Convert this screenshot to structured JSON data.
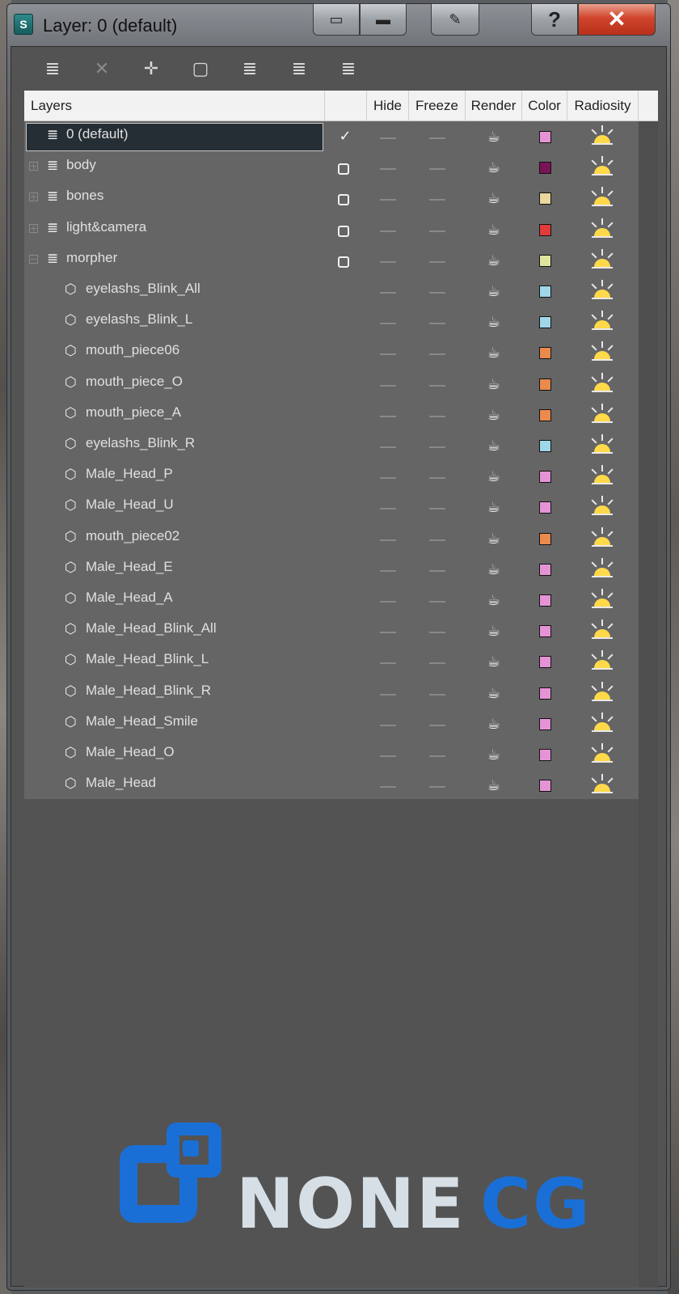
{
  "window": {
    "title": "Layer: 0 (default)",
    "title_buttons": {
      "help": "?",
      "close": "✕"
    }
  },
  "toolbar": {
    "tools": [
      {
        "name": "create-layer-tool",
        "glyph": "≣",
        "disabled": false
      },
      {
        "name": "delete-tool",
        "glyph": "✕",
        "disabled": true
      },
      {
        "name": "add-to-layer-tool",
        "glyph": "✛",
        "disabled": false
      },
      {
        "name": "select-objects-tool",
        "glyph": "▢",
        "disabled": false
      },
      {
        "name": "select-layer-tool",
        "glyph": "≣",
        "disabled": false
      },
      {
        "name": "set-current-layer-tool",
        "glyph": "≣",
        "disabled": false
      },
      {
        "name": "hide-freeze-all-tool",
        "glyph": "≣",
        "disabled": false
      }
    ]
  },
  "columns": {
    "layers": "Layers",
    "hide": "Hide",
    "freeze": "Freeze",
    "render": "Render",
    "color": "Color",
    "radiosity": "Radiosity"
  },
  "rows": [
    {
      "label": "0 (default)",
      "type": "layer",
      "expander": "",
      "current": "check",
      "color": "#e693d6",
      "selected": true
    },
    {
      "label": "body",
      "type": "layer",
      "expander": "+",
      "current": "box",
      "color": "#7b1357"
    },
    {
      "label": "bones",
      "type": "layer",
      "expander": "+",
      "current": "box",
      "color": "#ead79d"
    },
    {
      "label": "light&camera",
      "type": "layer",
      "expander": "+",
      "current": "box",
      "color": "#e23b3b"
    },
    {
      "label": "morpher",
      "type": "layer",
      "expander": "−",
      "current": "box",
      "color": "#dfe59e"
    },
    {
      "label": "eyelashs_Blink_All",
      "type": "object",
      "color": "#9fd6e8"
    },
    {
      "label": "eyelashs_Blink_L",
      "type": "object",
      "color": "#9fd6e8"
    },
    {
      "label": "mouth_piece06",
      "type": "object",
      "color": "#ea8a4d"
    },
    {
      "label": "mouth_piece_O",
      "type": "object",
      "color": "#ea8a4d"
    },
    {
      "label": "mouth_piece_A",
      "type": "object",
      "color": "#ea8a4d"
    },
    {
      "label": "eyelashs_Blink_R",
      "type": "object",
      "color": "#9fd6e8"
    },
    {
      "label": "Male_Head_P",
      "type": "object",
      "color": "#e693d6"
    },
    {
      "label": "Male_Head_U",
      "type": "object",
      "color": "#e693d6"
    },
    {
      "label": "mouth_piece02",
      "type": "object",
      "color": "#ea8a4d"
    },
    {
      "label": "Male_Head_E",
      "type": "object",
      "color": "#e693d6"
    },
    {
      "label": "Male_Head_A",
      "type": "object",
      "color": "#e693d6"
    },
    {
      "label": "Male_Head_Blink_All",
      "type": "object",
      "color": "#e693d6"
    },
    {
      "label": "Male_Head_Blink_L",
      "type": "object",
      "color": "#e693d6"
    },
    {
      "label": "Male_Head_Blink_R",
      "type": "object",
      "color": "#e693d6"
    },
    {
      "label": "Male_Head_Smile",
      "type": "object",
      "color": "#e693d6"
    },
    {
      "label": "Male_Head_O",
      "type": "object",
      "color": "#e693d6"
    },
    {
      "label": "Male_Head",
      "type": "object",
      "color": "#e693d6"
    }
  ],
  "watermark": {
    "part1": "NONE",
    "part2": "CG"
  },
  "colors": {
    "accent": "#1a6fd6",
    "selected_row": "#252e35"
  }
}
